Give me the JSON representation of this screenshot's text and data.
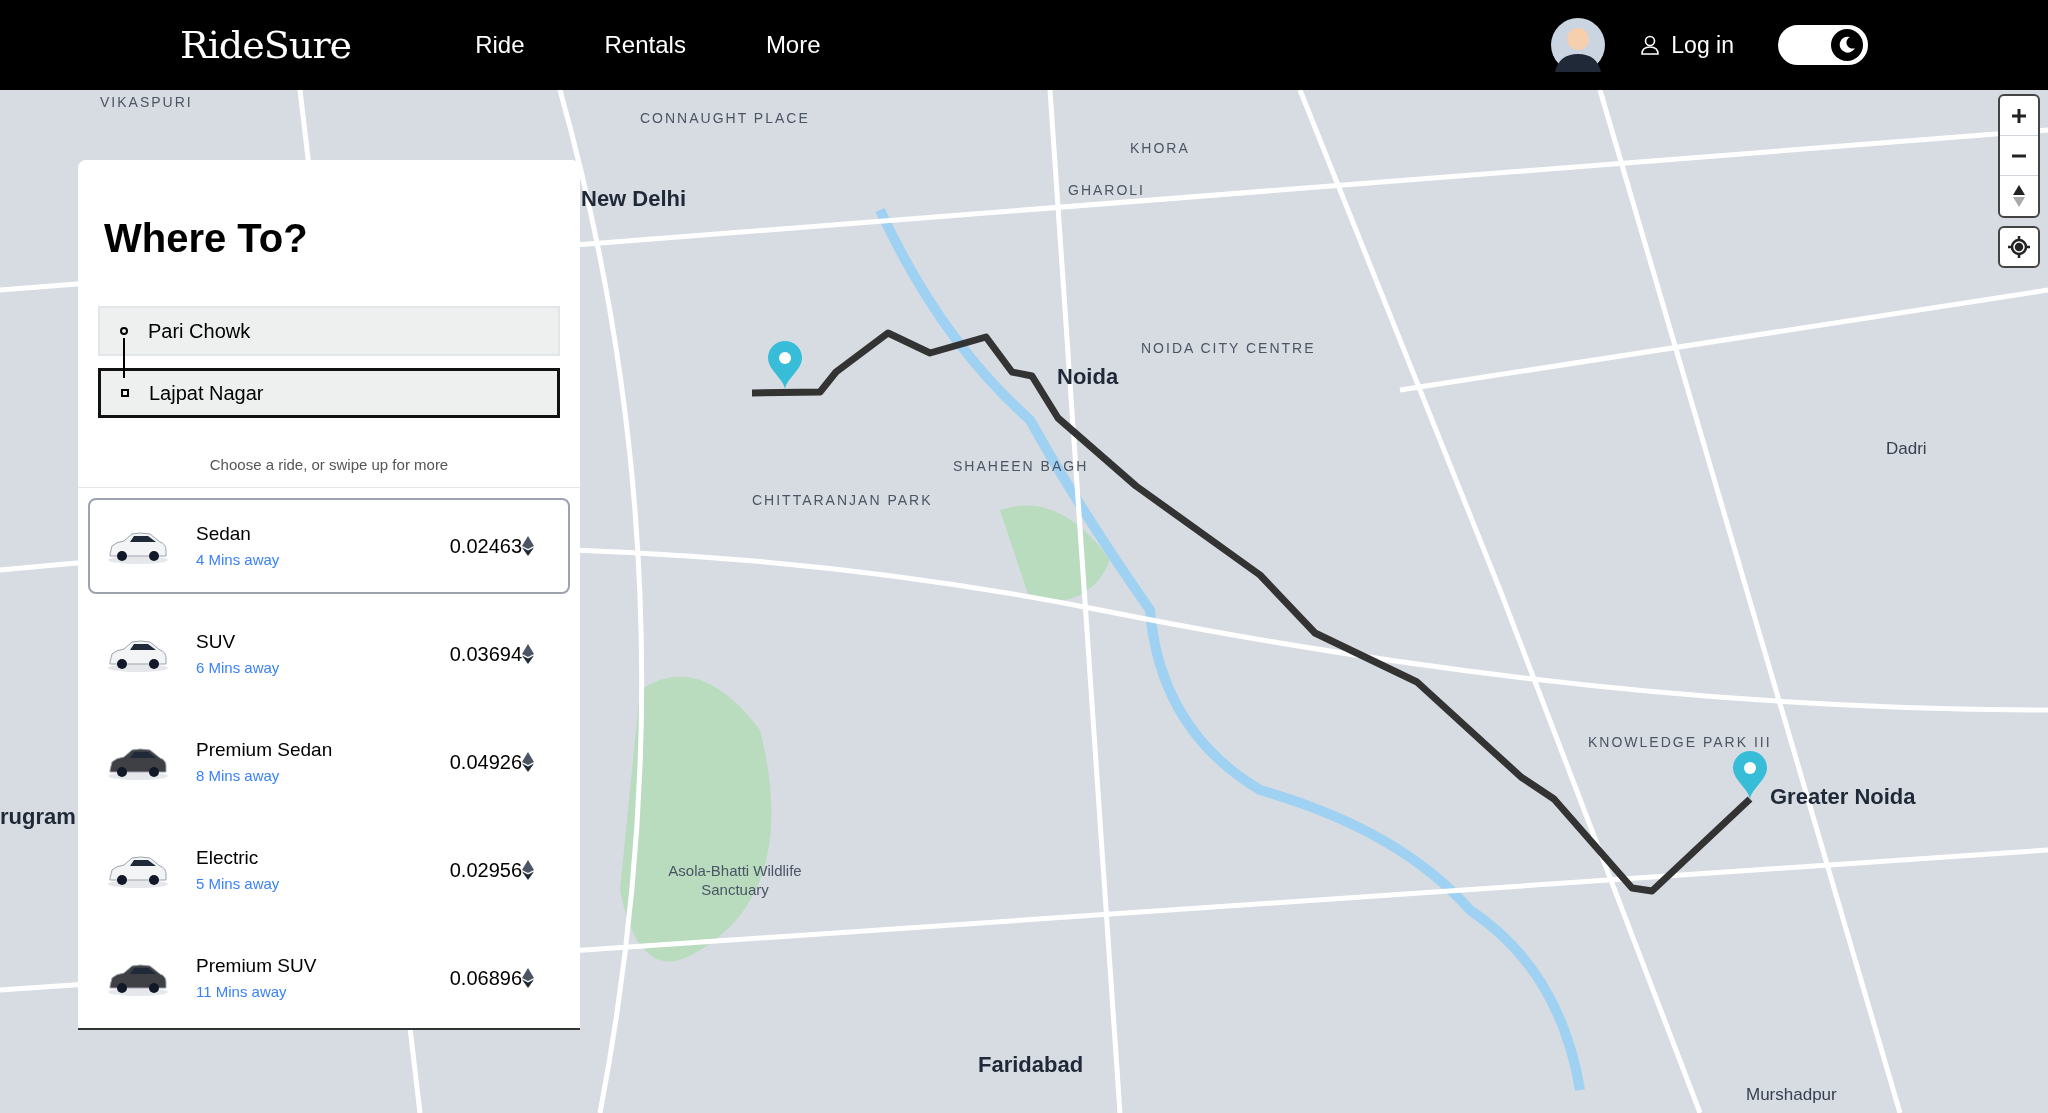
{
  "header": {
    "logo": "RideSure",
    "nav": [
      {
        "label": "Ride"
      },
      {
        "label": "Rentals"
      },
      {
        "label": "More"
      }
    ],
    "login": "Log in",
    "dark_mode_toggle": {
      "on": true
    }
  },
  "panel": {
    "title": "Where To?",
    "pickup": {
      "value": "Pari Chowk",
      "focused": false
    },
    "dropoff": {
      "value": "Lajpat Nagar",
      "focused": true
    },
    "hint": "Choose a ride, or swipe up for more",
    "rides": [
      {
        "name": "Sedan",
        "eta": "4 Mins away",
        "price": "0.02463",
        "selected": true,
        "color": "#f3f4f6"
      },
      {
        "name": "SUV",
        "eta": "6 Mins away",
        "price": "0.03694",
        "selected": false,
        "color": "#f3f4f6"
      },
      {
        "name": "Premium Sedan",
        "eta": "8 Mins away",
        "price": "0.04926",
        "selected": false,
        "color": "#3f3f46"
      },
      {
        "name": "Electric",
        "eta": "5 Mins away",
        "price": "0.02956",
        "selected": false,
        "color": "#f3f4f6"
      },
      {
        "name": "Premium SUV",
        "eta": "11 Mins away",
        "price": "0.06896",
        "selected": false,
        "color": "#3f3f46"
      }
    ]
  },
  "map": {
    "labels": [
      {
        "text": "VIKASPURI",
        "kind": "minor"
      },
      {
        "text": "CONNAUGHT PLACE",
        "kind": "minor"
      },
      {
        "text": "KHORA",
        "kind": "minor"
      },
      {
        "text": "GHAROLI",
        "kind": "minor"
      },
      {
        "text": "New Delhi",
        "kind": "major"
      },
      {
        "text": "NOIDA CITY CENTRE",
        "kind": "minor"
      },
      {
        "text": "Noida",
        "kind": "major"
      },
      {
        "text": "SHAHEEN BAGH",
        "kind": "minor"
      },
      {
        "text": "CHITTARANJAN PARK",
        "kind": "minor"
      },
      {
        "text": "Dadri",
        "kind": "town"
      },
      {
        "text": "KNOWLEDGE PARK III",
        "kind": "minor"
      },
      {
        "text": "Greater Noida",
        "kind": "major"
      },
      {
        "text": "rugram",
        "kind": "major"
      },
      {
        "text": "Asola-Bhatti Wildlife Sanctuary",
        "kind": "park"
      },
      {
        "text": "Faridabad",
        "kind": "major"
      },
      {
        "text": "Murshadpur",
        "kind": "town"
      }
    ]
  }
}
